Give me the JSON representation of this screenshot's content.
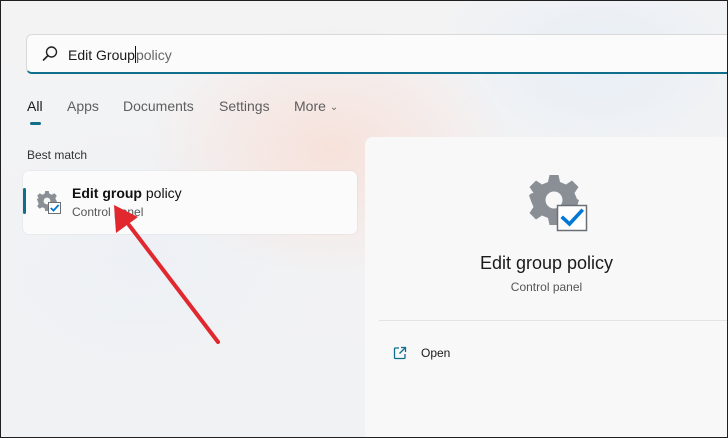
{
  "search": {
    "typed": "Edit Group",
    "suggestion": "policy"
  },
  "tabs": [
    {
      "label": "All",
      "active": true
    },
    {
      "label": "Apps"
    },
    {
      "label": "Documents"
    },
    {
      "label": "Settings"
    },
    {
      "label": "More"
    }
  ],
  "best_match": {
    "heading": "Best match",
    "result": {
      "title_bold": "Edit group",
      "title_rest": "policy",
      "subtitle": "Control panel",
      "icon": "gear-checkbox-icon"
    }
  },
  "detail": {
    "title": "Edit group policy",
    "subtitle": "Control panel",
    "icon": "gear-checkbox-icon",
    "actions": [
      {
        "label": "Open",
        "icon": "open-external-icon"
      }
    ]
  },
  "colors": {
    "accent": "#0e6e8c",
    "annotation_arrow": "#e0282e"
  }
}
